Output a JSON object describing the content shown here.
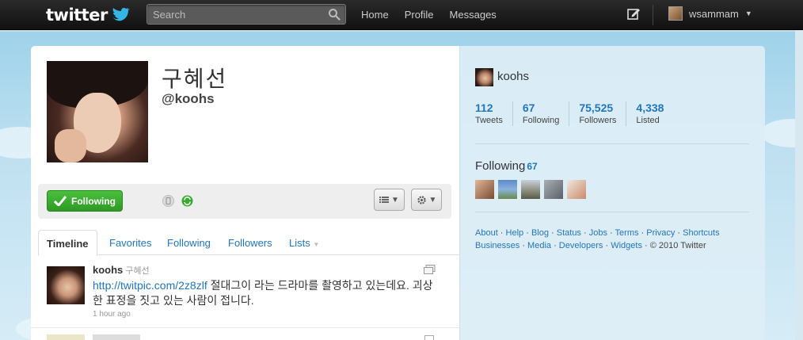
{
  "topbar": {
    "logo_text": "twitter",
    "search_placeholder": "Search",
    "nav": [
      "Home",
      "Profile",
      "Messages"
    ],
    "username": "wsammam"
  },
  "profile": {
    "name": "구혜선",
    "handle": "@koohs"
  },
  "actions": {
    "follow_label": "Following"
  },
  "tabs": [
    "Timeline",
    "Favorites",
    "Following",
    "Followers",
    "Lists"
  ],
  "tweet": {
    "author": "koohs",
    "fullname": "구혜선",
    "link": "http://twitpic.com/2z8zlf",
    "text": " 절대그이 라는 드라마를 촬영하고 있는데요. 괴상한 표정을 짓고 있는 사람이 접니다.",
    "time": "1 hour ago"
  },
  "dashboard": {
    "handle": "koohs",
    "stats": [
      {
        "num": "112",
        "label": "Tweets"
      },
      {
        "num": "67",
        "label": "Following"
      },
      {
        "num": "75,525",
        "label": "Followers"
      },
      {
        "num": "4,338",
        "label": "Listed"
      }
    ],
    "following_title": "Following",
    "following_count": "67",
    "footer_links_row1": [
      "About",
      "Help",
      "Blog",
      "Status",
      "Jobs",
      "Terms",
      "Privacy",
      "Shortcuts"
    ],
    "footer_links_row2": [
      "Businesses",
      "Media",
      "Developers",
      "Widgets"
    ],
    "copyright": "© 2010 Twitter"
  },
  "colors": {
    "link": "#2276bb",
    "follow_green": "#3aaa2f",
    "background": "#c0deed"
  }
}
